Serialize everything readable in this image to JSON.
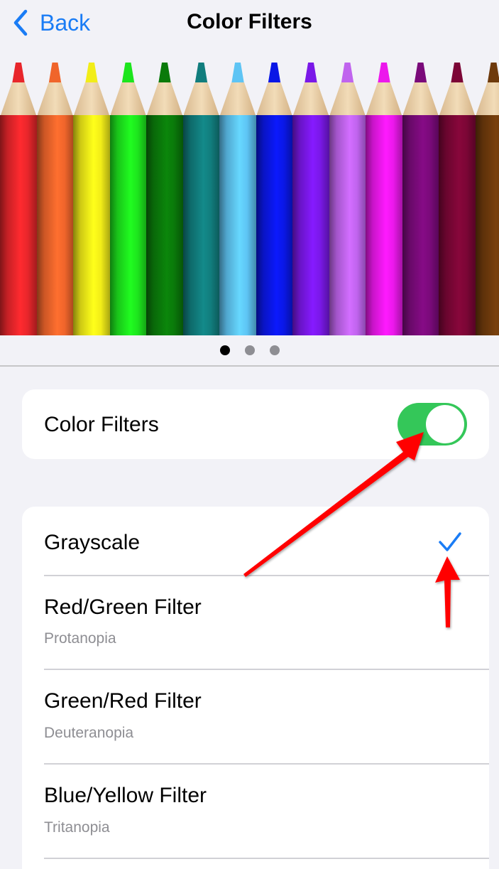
{
  "nav": {
    "back_label": "Back",
    "title": "Color Filters"
  },
  "carousel": {
    "pencil_colors": [
      "#e8262b",
      "#f0652b",
      "#f2ed18",
      "#1de51d",
      "#0a7a0a",
      "#117d7d",
      "#5ec4f4",
      "#0a17e6",
      "#7a18e8",
      "#c064ee",
      "#ec18ec",
      "#7a0a7a",
      "#7c0636",
      "#6e3a0c"
    ],
    "page_count": 3,
    "active_page": 1
  },
  "toggle_card": {
    "label": "Color Filters",
    "enabled": true,
    "toggle_color": "#34c759"
  },
  "filters": [
    {
      "label": "Grayscale",
      "sublabel": "",
      "selected": true
    },
    {
      "label": "Red/Green Filter",
      "sublabel": "Protanopia",
      "selected": false
    },
    {
      "label": "Green/Red Filter",
      "sublabel": "Deuteranopia",
      "selected": false
    },
    {
      "label": "Blue/Yellow Filter",
      "sublabel": "Tritanopia",
      "selected": false
    }
  ],
  "colors": {
    "accent": "#1a7cf5",
    "annotation": "#ff0000"
  }
}
